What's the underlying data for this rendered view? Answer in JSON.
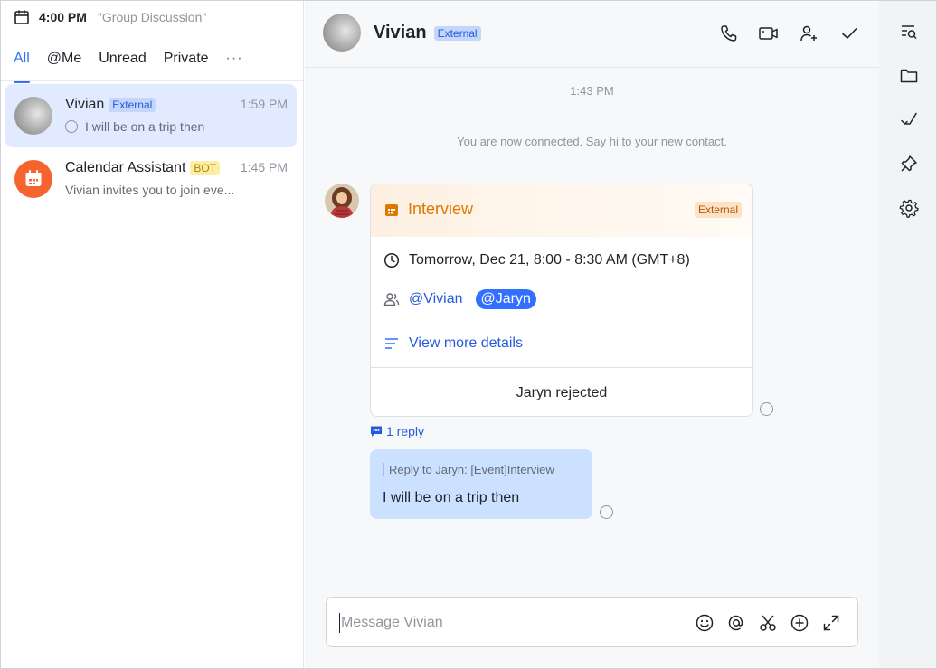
{
  "topbar": {
    "time": "4:00 PM",
    "context": "\"Group Discussion\""
  },
  "tabs": [
    {
      "label": "All"
    },
    {
      "label": "@Me"
    },
    {
      "label": "Unread"
    },
    {
      "label": "Private"
    }
  ],
  "tabs_more": "···",
  "conversations": [
    {
      "name": "Vivian",
      "tag": "External",
      "time": "1:59 PM",
      "preview": "I will be on a trip then"
    },
    {
      "name": "Calendar Assistant",
      "tag": "BOT",
      "time": "1:45 PM",
      "preview": "Vivian invites you to join eve..."
    }
  ],
  "chat_header": {
    "name": "Vivian",
    "tag": "External"
  },
  "messages": {
    "timestamp": "1:43 PM",
    "system": "You are now connected. Say hi to your new contact.",
    "card": {
      "title": "Interview",
      "tag": "External",
      "time": "Tomorrow, Dec 21, 8:00 - 8:30 AM (GMT+8)",
      "attendee_1": "@Vivian",
      "attendee_2": "@Jaryn",
      "details_link": "View more details",
      "footer": "Jaryn rejected"
    },
    "reply_count": "1 reply",
    "bubble": {
      "quote": "Reply to Jaryn:  [Event]Interview",
      "text": "I will be on a trip then"
    }
  },
  "composer": {
    "placeholder": "Message Vivian"
  },
  "colors": {
    "accent": "#3370ff",
    "selected_bg": "#e1eaff",
    "card_orange": "#de7802",
    "bubble_bg": "#cce0ff"
  },
  "icons": {
    "header": [
      "phone-icon",
      "video-icon",
      "add-member-icon",
      "check-icon"
    ],
    "composer": [
      "emoji-icon",
      "mention-icon",
      "scissors-icon",
      "plus-circle-icon",
      "expand-icon"
    ],
    "rail": [
      "search-messages-icon",
      "folder-icon",
      "done-icon",
      "pin-icon",
      "settings-icon"
    ]
  }
}
